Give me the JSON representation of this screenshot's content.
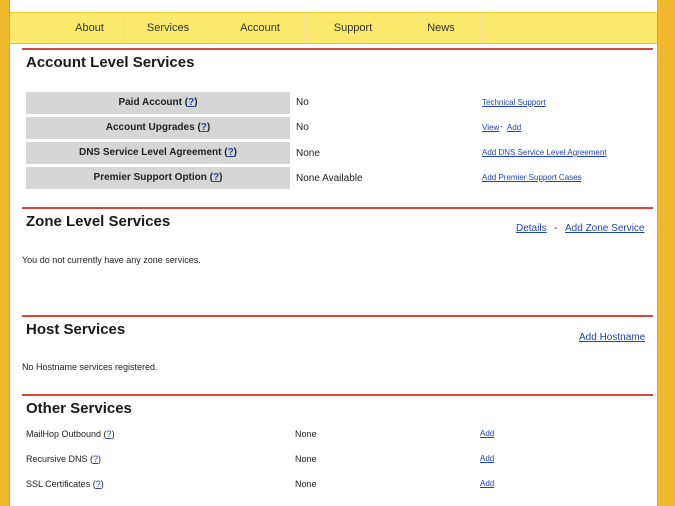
{
  "nav": {
    "items": [
      "About",
      "Services",
      "Account",
      "Support",
      "News"
    ]
  },
  "account": {
    "title": "Account Level Services",
    "rows": [
      {
        "label": "Paid Account",
        "help": "?",
        "value": "No",
        "links": [
          "Technical Support"
        ]
      },
      {
        "label": "Account Upgrades",
        "help": "?",
        "value": "No",
        "links": [
          "View",
          "Add"
        ],
        "link_sep": "-"
      },
      {
        "label": "DNS Service Level Agreement",
        "help": "?",
        "value": "None",
        "links": [
          "Add DNS Service Level Agreement"
        ]
      },
      {
        "label": "Premier Support Option",
        "help": "?",
        "value": "None Available",
        "links": [
          "Add Premier Support Cases"
        ]
      }
    ]
  },
  "zone": {
    "title": "Zone Level Services",
    "details_link": "Details",
    "sep": "-",
    "add_link": "Add Zone Service",
    "message": "You do not currently have any zone services."
  },
  "host": {
    "title": "Host Services",
    "add_link": "Add Hostname",
    "message": "No Hostname services registered."
  },
  "other": {
    "title": "Other Services",
    "rows": [
      {
        "label": "MailHop Outbound",
        "help": "?",
        "value": "None",
        "link": "Add"
      },
      {
        "label": "Recursive DNS",
        "help": "?",
        "value": "None",
        "link": "Add"
      },
      {
        "label": "SSL Certificates",
        "help": "?",
        "value": "None",
        "link": "Add"
      }
    ]
  }
}
